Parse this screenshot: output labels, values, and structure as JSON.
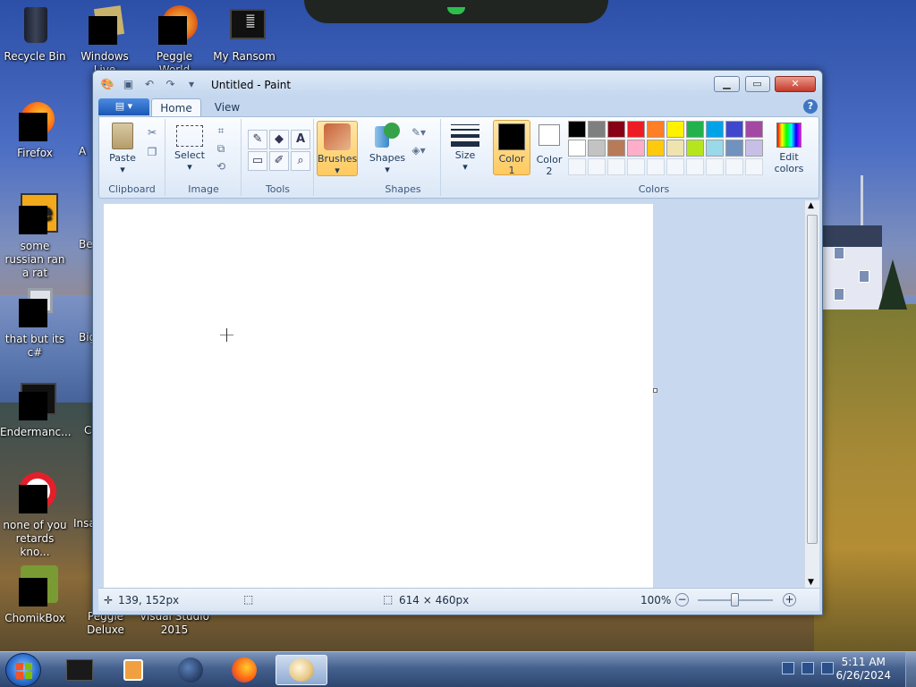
{
  "desktop": {
    "icons": [
      {
        "label": "Recycle Bin",
        "icon": "recycle-bin-icon"
      },
      {
        "label": "Windows Live",
        "icon": "windows-live-icon"
      },
      {
        "label": "Peggle World",
        "icon": "peggle-icon"
      },
      {
        "label": "My Ransom",
        "icon": "text-document-icon"
      },
      {
        "label": "Firefox",
        "icon": "firefox-icon"
      },
      {
        "label": "some russian ran a rat",
        "icon": "exe-icon"
      },
      {
        "label": "that but its c#",
        "icon": "files-icon"
      },
      {
        "label": "Endermanc...",
        "icon": "text-document-icon"
      },
      {
        "label": "none of you retards kno...",
        "icon": "opera-icon"
      },
      {
        "label": "ChomikBox",
        "icon": "chomikbox-icon"
      },
      {
        "label": "Peggle Deluxe",
        "icon": "peggle-icon"
      },
      {
        "label": "Visual Studio 2015",
        "icon": "visual-studio-icon"
      }
    ],
    "partial_labels": [
      "A",
      "Be",
      "Big",
      "C",
      "Insa"
    ]
  },
  "paint": {
    "title": "Untitled - Paint",
    "tabs": {
      "home": "Home",
      "view": "View"
    },
    "help": "?",
    "groups": {
      "clipboard": "Clipboard",
      "image": "Image",
      "tools": "Tools",
      "shapes": "Shapes",
      "colors": "Colors"
    },
    "buttons": {
      "paste": "Paste",
      "select": "Select",
      "brushes": "Brushes",
      "shapes": "Shapes",
      "size": "Size",
      "color1_line1": "Color",
      "color1_line2": "1",
      "color2_line1": "Color",
      "color2_line2": "2",
      "edit_colors_line1": "Edit",
      "edit_colors_line2": "colors"
    },
    "tools": {
      "pencil": "✎",
      "fill": "◆",
      "text": "A",
      "eraser": "▭",
      "picker": "✐",
      "magnifier": "⌕"
    },
    "color1": "#000000",
    "color2": "#ffffff",
    "palette_row1": [
      "#000000",
      "#7f7f7f",
      "#880015",
      "#ed1c24",
      "#ff7f27",
      "#fff200",
      "#22b14c",
      "#00a2e8",
      "#3f48cc",
      "#a349a4"
    ],
    "palette_row2": [
      "#ffffff",
      "#c3c3c3",
      "#b97a57",
      "#ffaec9",
      "#ffc90e",
      "#efe4b0",
      "#b5e61d",
      "#99d9ea",
      "#7092be",
      "#c8bfe7"
    ],
    "status": {
      "cursor": "139, 152px",
      "size": "614 × 460px",
      "zoom": "100%",
      "minus": "−",
      "plus": "+"
    }
  },
  "taskbar": {
    "time": "5:11 AM",
    "date": "6/26/2024"
  }
}
